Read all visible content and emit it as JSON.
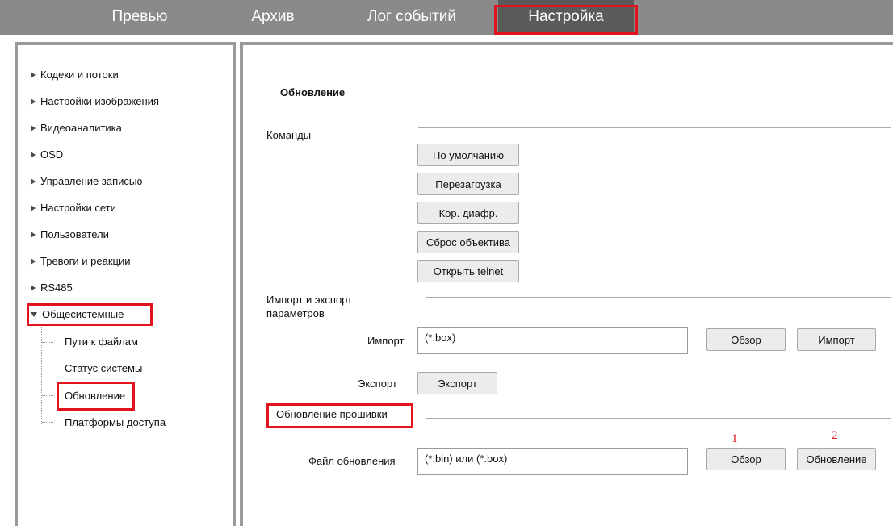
{
  "top_nav": {
    "tabs": [
      {
        "label": "Превью"
      },
      {
        "label": "Архив"
      },
      {
        "label": "Лог событий"
      },
      {
        "label": "Настройка"
      }
    ],
    "active_tab": "Настройка"
  },
  "sidebar": {
    "items": [
      {
        "label": "Кодеки и потоки"
      },
      {
        "label": "Настройки изображения"
      },
      {
        "label": "Видеоаналитика"
      },
      {
        "label": "OSD"
      },
      {
        "label": "Управление записью"
      },
      {
        "label": "Настройки сети"
      },
      {
        "label": "Пользователи"
      },
      {
        "label": "Тревоги и реакции"
      },
      {
        "label": "RS485"
      },
      {
        "label": "Общесистемные"
      }
    ],
    "subitems": [
      {
        "label": "Пути к файлам"
      },
      {
        "label": "Статус системы"
      },
      {
        "label": "Обновление"
      },
      {
        "label": "Платформы доступа"
      }
    ],
    "active_subitem": "Обновление"
  },
  "main": {
    "title": "Обновление",
    "commands": {
      "label": "Команды",
      "buttons": [
        {
          "label": "По умолчанию"
        },
        {
          "label": "Перезагрузка"
        },
        {
          "label": "Кор. диафр."
        },
        {
          "label": "Сброс объектива"
        },
        {
          "label": "Открыть telnet"
        }
      ]
    },
    "import_export": {
      "label": "Импорт и экспорт параметров",
      "import_label": "Импорт",
      "import_value": "(*.box)",
      "browse_label": "Обзор",
      "import_button": "Импорт",
      "export_label": "Экспорт",
      "export_button": "Экспорт"
    },
    "firmware": {
      "label": "Обновление прошивки",
      "file_label": "Файл обновления",
      "file_value": "(*.bin) или (*.box)",
      "browse_label": "Обзор",
      "update_button": "Обновление",
      "step_markers": [
        "1",
        "2"
      ]
    }
  },
  "colors": {
    "highlight": "#e0141e",
    "topbar": "#8a8a8a",
    "active_tab": "#5a5a5a"
  }
}
